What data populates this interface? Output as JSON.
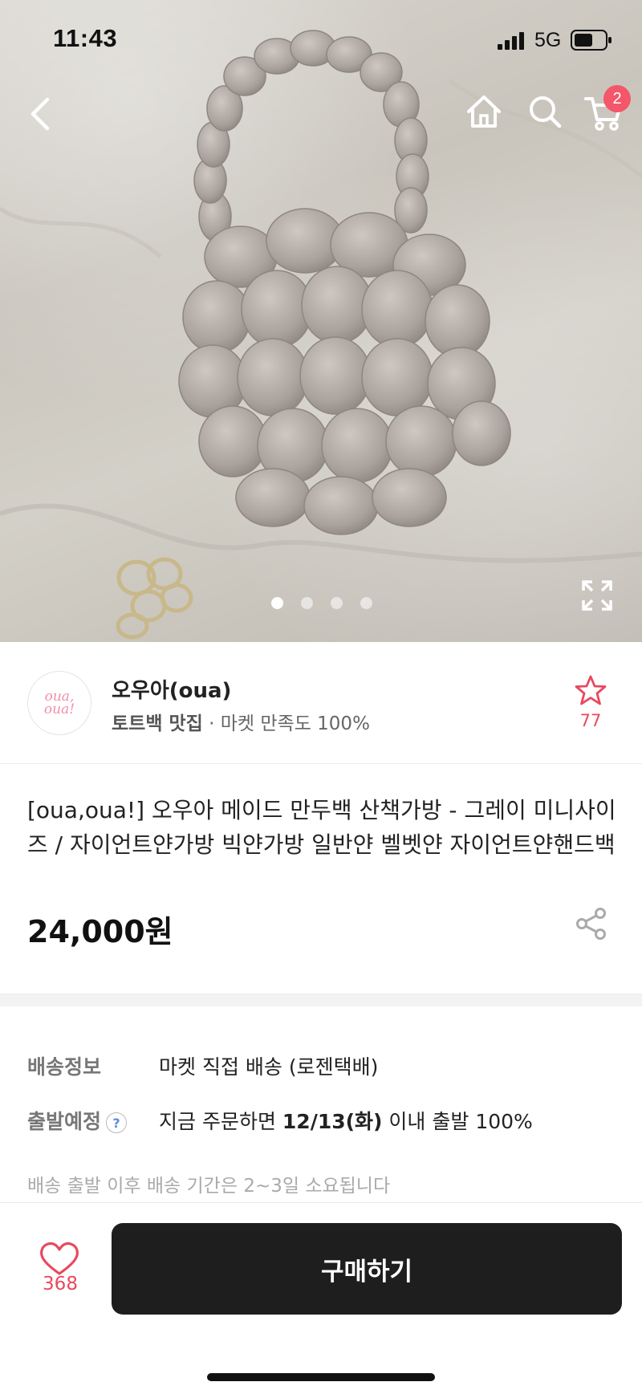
{
  "status_bar": {
    "time": "11:43",
    "network": "5G"
  },
  "header": {
    "cart_count": "2"
  },
  "gallery": {
    "total_images": 4,
    "active_index": 0
  },
  "seller": {
    "logo_text": "oua, oua!",
    "name": "오우아(oua)",
    "tag": "토트백 맛집",
    "satisfaction": " · 마켓 만족도 100%",
    "favorite_count": "77"
  },
  "product": {
    "title": "[oua,oua!] 오우아 메이드 만두백 산책가방 - 그레이 미니사이즈 / 자이언트얀가방 빅얀가방 일반얀 벨벳얀 자이언트얀핸드백",
    "price": "24,000원"
  },
  "shipping": {
    "info_label": "배송정보",
    "info_value": "마켓 직접 배송 (로젠택배)",
    "depart_label": "출발예정",
    "help_icon": "?",
    "depart_prefix": "지금 주문하면 ",
    "depart_date": "12/13(화)",
    "depart_suffix": " 이내 출발 100%",
    "note": "배송 출발 이후 배송 기간은 2~3일 소요됩니다"
  },
  "bottom_bar": {
    "like_count": "368",
    "buy_label": "구매하기"
  },
  "colors": {
    "accent": "#e9495e",
    "badge": "#f4566a",
    "buy_button": "#1e1e1e"
  }
}
